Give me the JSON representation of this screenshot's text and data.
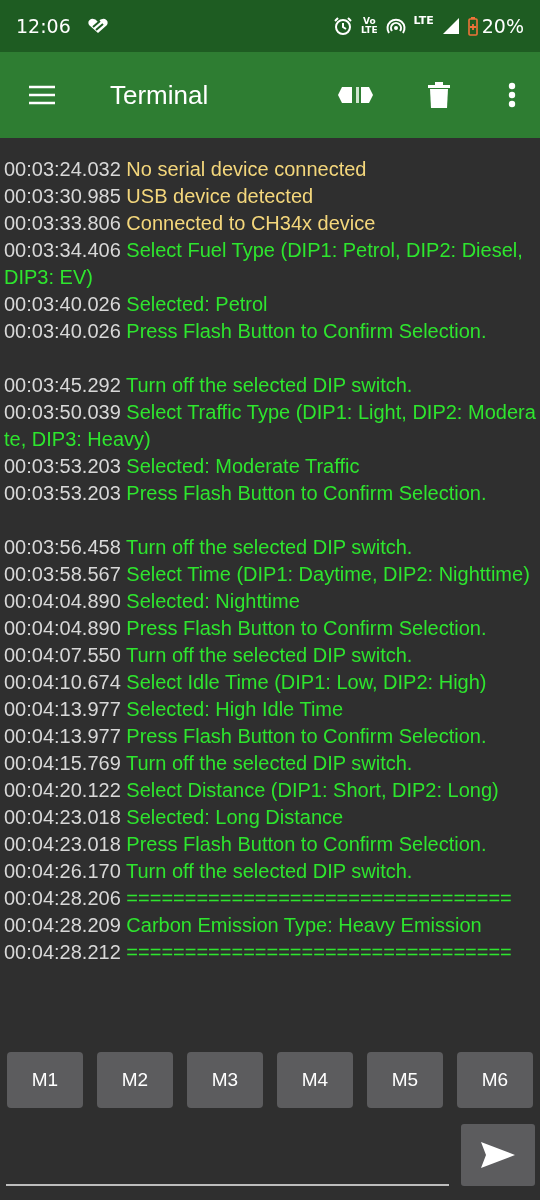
{
  "status_bar": {
    "time": "12:06",
    "volte": [
      "Vo",
      "LTE"
    ],
    "network": "LTE",
    "battery": "20%"
  },
  "toolbar": {
    "title": "Terminal"
  },
  "log": [
    {
      "kind": "status",
      "time": "00:03:24.032",
      "message": "No serial device connected"
    },
    {
      "kind": "status",
      "time": "00:03:30.985",
      "message": "USB device detected"
    },
    {
      "kind": "status",
      "time": "00:03:33.806",
      "message": "Connected to CH34x device"
    },
    {
      "kind": "received",
      "time": "00:03:34.406",
      "message": "Select Fuel Type (DIP1: Petrol, DIP2: Diesel, DIP3: EV)"
    },
    {
      "kind": "received",
      "time": "00:03:40.026",
      "message": "Selected: Petrol"
    },
    {
      "kind": "received",
      "time": "00:03:40.026",
      "message": "Press Flash Button to Confirm Selection."
    },
    {
      "kind": "blank"
    },
    {
      "kind": "received",
      "time": "00:03:45.292",
      "message": "Turn off the selected DIP switch."
    },
    {
      "kind": "received",
      "time": "00:03:50.039",
      "message": "Select Traffic Type (DIP1: Light, DIP2: Moderate, DIP3: Heavy)"
    },
    {
      "kind": "received",
      "time": "00:03:53.203",
      "message": "Selected: Moderate Traffic"
    },
    {
      "kind": "received",
      "time": "00:03:53.203",
      "message": "Press Flash Button to Confirm Selection."
    },
    {
      "kind": "blank"
    },
    {
      "kind": "received",
      "time": "00:03:56.458",
      "message": "Turn off the selected DIP switch."
    },
    {
      "kind": "received",
      "time": "00:03:58.567",
      "message": "Select Time (DIP1: Daytime, DIP2: Nighttime)"
    },
    {
      "kind": "received",
      "time": "00:04:04.890",
      "message": "Selected: Nighttime"
    },
    {
      "kind": "received",
      "time": "00:04:04.890",
      "message": "Press Flash Button to Confirm Selection."
    },
    {
      "kind": "received",
      "time": "00:04:07.550",
      "message": "Turn off the selected DIP switch."
    },
    {
      "kind": "received",
      "time": "00:04:10.674",
      "message": "Select Idle Time (DIP1: Low, DIP2: High)"
    },
    {
      "kind": "received",
      "time": "00:04:13.977",
      "message": "Selected: High Idle Time"
    },
    {
      "kind": "received",
      "time": "00:04:13.977",
      "message": "Press Flash Button to Confirm Selection."
    },
    {
      "kind": "received",
      "time": "00:04:15.769",
      "message": "Turn off the selected DIP switch."
    },
    {
      "kind": "received",
      "time": "00:04:20.122",
      "message": "Select Distance (DIP1: Short, DIP2: Long)"
    },
    {
      "kind": "received",
      "time": "00:04:23.018",
      "message": "Selected: Long Distance"
    },
    {
      "kind": "received",
      "time": "00:04:23.018",
      "message": "Press Flash Button to Confirm Selection."
    },
    {
      "kind": "received",
      "time": "00:04:26.170",
      "message": "Turn off the selected DIP switch."
    },
    {
      "kind": "received",
      "time": "00:04:28.206",
      "message": "================================="
    },
    {
      "kind": "received",
      "time": "00:04:28.209",
      "message": "Carbon Emission Type: Heavy Emission"
    },
    {
      "kind": "received",
      "time": "00:04:28.212",
      "message": "================================="
    }
  ],
  "macros": [
    "M1",
    "M2",
    "M3",
    "M4",
    "M5",
    "M6"
  ]
}
